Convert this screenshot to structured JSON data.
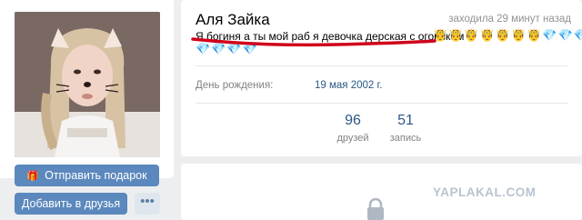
{
  "profile": {
    "name": "Аля Зайка",
    "last_seen": "заходила 29 минут назад",
    "status": "Я богиня а ты мой раб я девочка дерская с огоньком",
    "status_emojis_line1": [
      "🤴",
      "🤴",
      "🤴",
      "🤴",
      "🤴",
      "🤴",
      "🤴",
      "💎",
      "💎",
      "💎"
    ],
    "status_emojis_line2": [
      "💎",
      "💎",
      "💎",
      "💎"
    ],
    "birthday_label": "День рождения:",
    "birthday_value": "19 мая 2002 г."
  },
  "stats": [
    {
      "value": "96",
      "label": "друзей"
    },
    {
      "value": "51",
      "label": "запись"
    }
  ],
  "actions": {
    "gift_label": "Отправить подарок",
    "add_friend_label": "Добавить в друзья",
    "more_label": "•••"
  },
  "watermark": "YAPLAKAL.COM",
  "colors": {
    "accent": "#5b88bd",
    "link": "#2a5885",
    "annotation_line": "#d0011b"
  }
}
